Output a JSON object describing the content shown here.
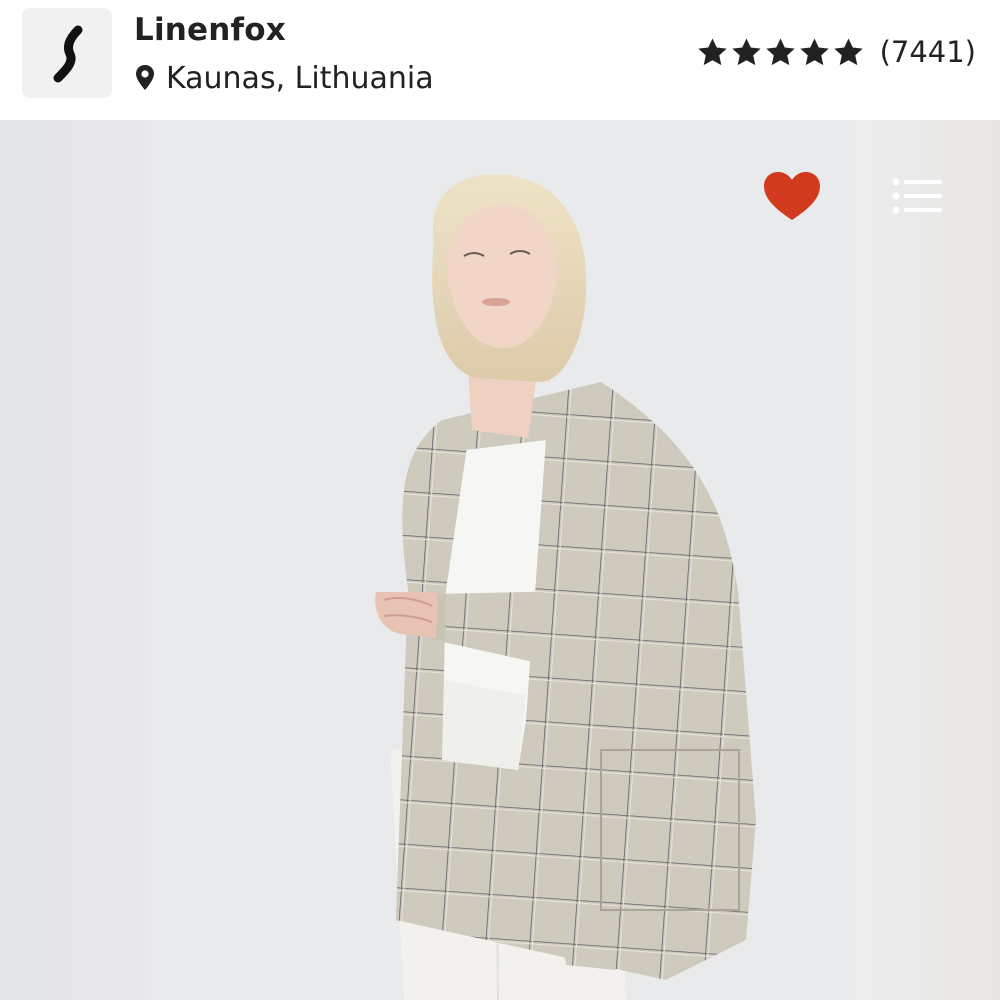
{
  "shop": {
    "name": "Linenfox",
    "location": "Kaunas, Lithuania",
    "logo_icon": "wave-stroke-icon"
  },
  "rating": {
    "stars": 5,
    "max_stars": 5,
    "review_count_label": "(7441)"
  },
  "gallery": {
    "image_subject": "woman-in-checked-linen-jacket-icon",
    "favorite_icon": "heart-icon",
    "favorite_color": "#d23a1f",
    "menu_icon": "list-icon"
  },
  "colors": {
    "background": "#ffffff",
    "gallery_bg": "#e7e7e9",
    "text": "#222222"
  }
}
